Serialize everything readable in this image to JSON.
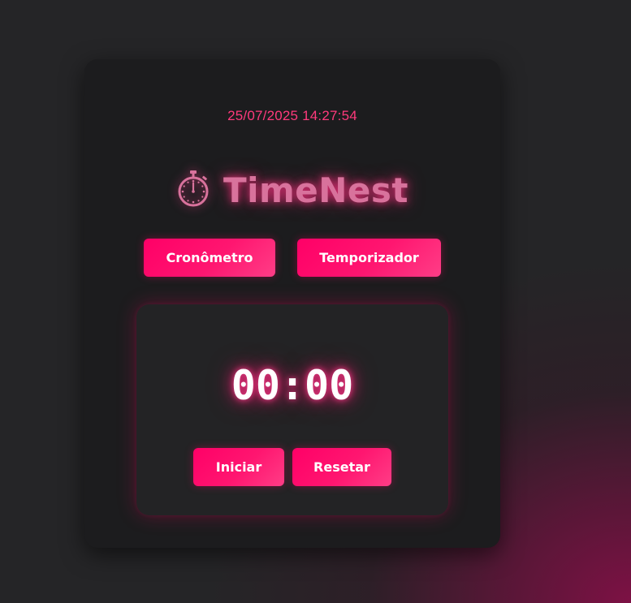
{
  "header": {
    "datetime": "25/07/2025 14:27:54",
    "app_title": "TimeNest",
    "brand_icon": "stopwatch-icon"
  },
  "tabs": [
    {
      "label": "Cronômetro"
    },
    {
      "label": "Temporizador"
    }
  ],
  "timer": {
    "display": "00:00",
    "start_label": "Iniciar",
    "reset_label": "Resetar"
  },
  "colors": {
    "accent": "#ff0067",
    "card_background": "#1c1c1e",
    "page_background": "#252527",
    "datetime_text": "#ff3a7c",
    "title_text": "#d8729c"
  }
}
